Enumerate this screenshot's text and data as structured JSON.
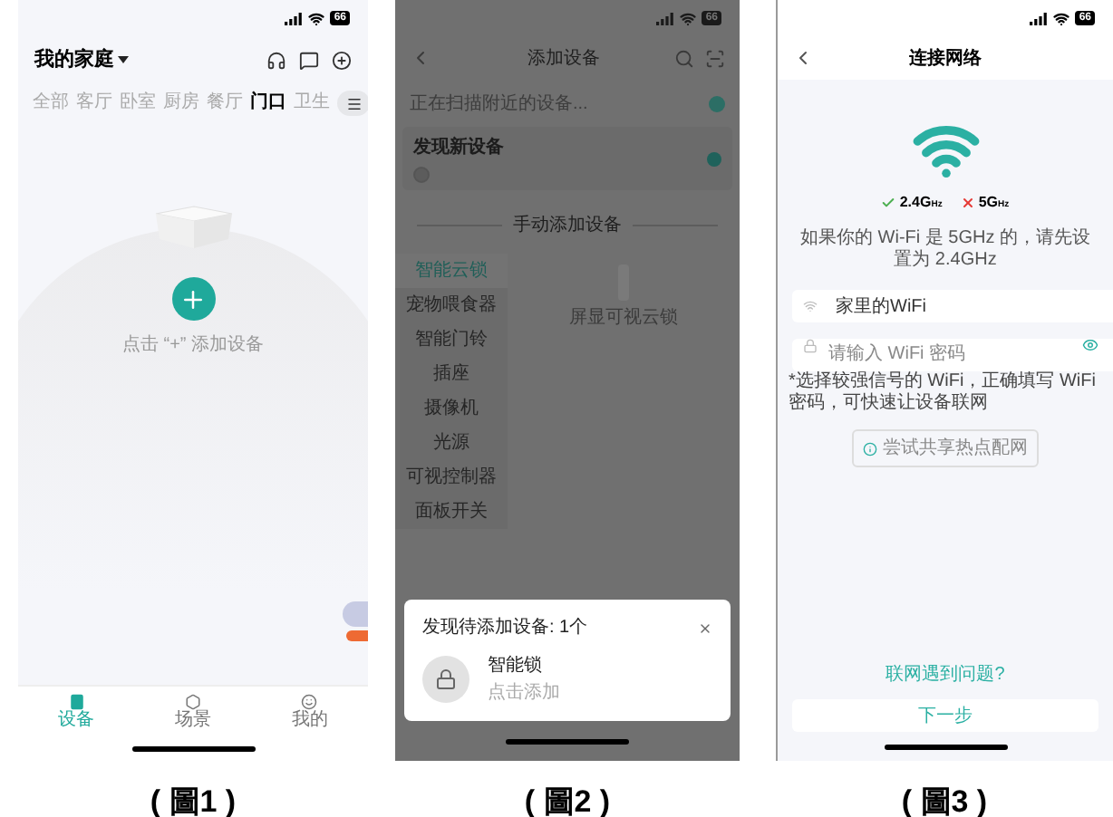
{
  "home_screen": {
    "status_bar": {
      "battery": "66"
    },
    "title": "我的家庭",
    "tabs": [
      {
        "label": "全部",
        "selected": false
      },
      {
        "label": "客厅",
        "selected": false
      },
      {
        "label": "卧室",
        "selected": false
      },
      {
        "label": "厨房",
        "selected": false
      },
      {
        "label": "餐厅",
        "selected": false
      },
      {
        "label": "门口",
        "selected": true
      },
      {
        "label": "卫生",
        "selected": false
      }
    ],
    "empty_state": {
      "hint": "点击 “+” 添加设备"
    },
    "bottom_nav": [
      {
        "label": "设备",
        "selected": true
      },
      {
        "label": "场景",
        "selected": false
      },
      {
        "label": "我的",
        "selected": false
      }
    ],
    "caption": "( 圖1 )"
  },
  "add_device_screen": {
    "status_bar": {
      "battery": "66"
    },
    "title": "添加设备",
    "scanning_text": "正在扫描附近的设备...",
    "discovered_title": "发现新设备",
    "manual_section_title": "手动添加设备",
    "categories": [
      {
        "label": "智能云锁",
        "selected": true
      },
      {
        "label": "宠物喂食器",
        "selected": false
      },
      {
        "label": "智能门铃",
        "selected": false
      },
      {
        "label": "插座",
        "selected": false
      },
      {
        "label": "摄像机",
        "selected": false
      },
      {
        "label": "光源",
        "selected": false
      },
      {
        "label": "可视控制器",
        "selected": false
      },
      {
        "label": "面板开关",
        "selected": false
      }
    ],
    "products": [
      {
        "name": "屏显可视云锁"
      }
    ],
    "dialog": {
      "title": "发现待添加设备: 1个",
      "device_name": "智能锁",
      "action": "点击添加"
    },
    "caption": "( 圖2 )"
  },
  "wifi_screen": {
    "status_bar": {
      "battery": "66"
    },
    "title": "连接网络",
    "bands": [
      {
        "label": "2.4G",
        "unit": "Hz",
        "supported": true
      },
      {
        "label": "5G",
        "unit": "Hz",
        "supported": false
      }
    ],
    "note": "如果你的 Wi-Fi 是 5GHz 的，请先设置为 2.4GHz",
    "network_field": {
      "value": "家里的WiFi"
    },
    "password_field": {
      "placeholder": "请输入 WiFi 密码"
    },
    "tip": "*选择较强信号的 WiFi，正确填写 WiFi 密码，可快速让设备联网",
    "hotspot_button": "尝试共享热点配网",
    "help_link": "联网遇到问题?",
    "next_button": "下一步",
    "caption": "( 圖3 )"
  }
}
